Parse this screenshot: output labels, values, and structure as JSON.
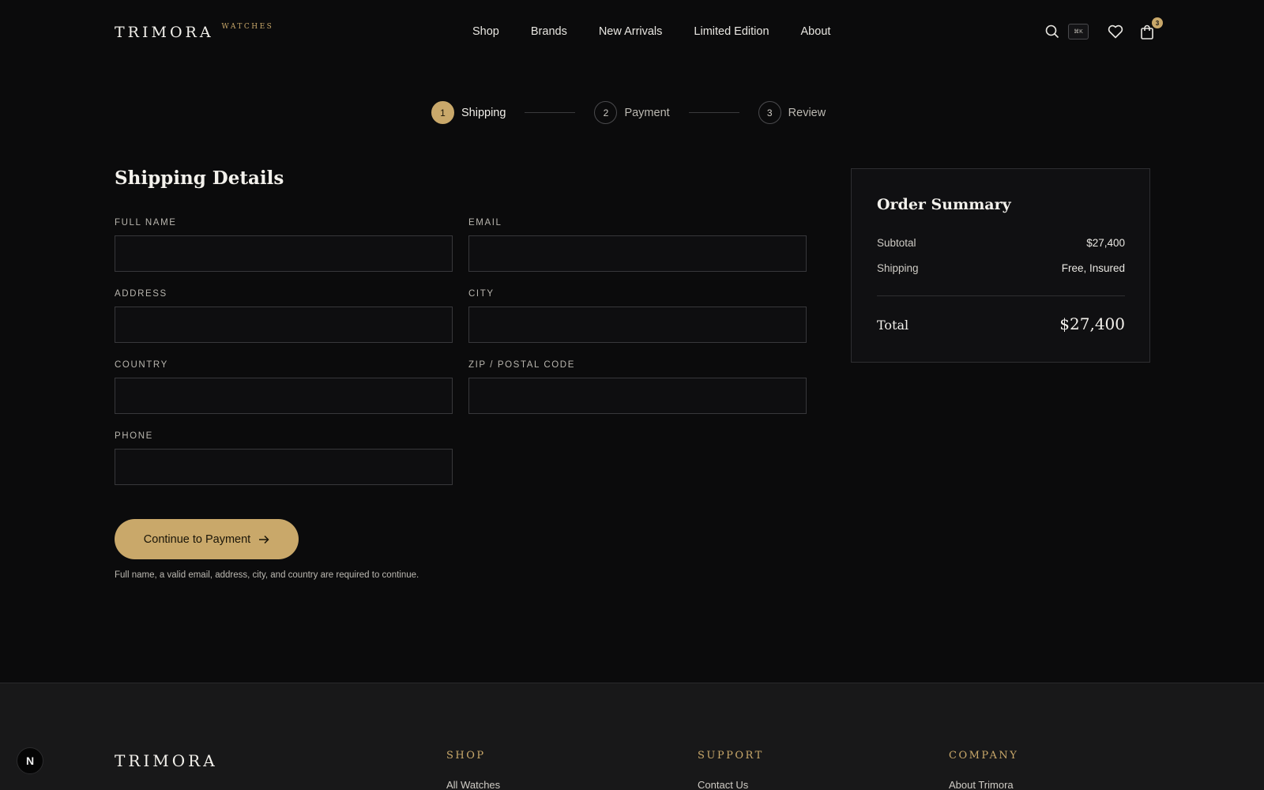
{
  "header": {
    "logo": "TRIMORA",
    "logo_sub": "WATCHES",
    "nav": [
      "Shop",
      "Brands",
      "New Arrivals",
      "Limited Edition",
      "About"
    ],
    "kbd_hint": "⌘K",
    "cart_count": "3"
  },
  "stepper": {
    "steps": [
      {
        "num": "1",
        "label": "Shipping"
      },
      {
        "num": "2",
        "label": "Payment"
      },
      {
        "num": "3",
        "label": "Review"
      }
    ]
  },
  "form": {
    "title": "Shipping Details",
    "fields": {
      "full_name": {
        "label": "FULL NAME",
        "value": ""
      },
      "email": {
        "label": "EMAIL",
        "value": ""
      },
      "address": {
        "label": "ADDRESS",
        "value": ""
      },
      "city": {
        "label": "CITY",
        "value": ""
      },
      "country": {
        "label": "COUNTRY",
        "value": ""
      },
      "zip": {
        "label": "ZIP / POSTAL CODE",
        "value": ""
      },
      "phone": {
        "label": "PHONE",
        "value": ""
      }
    },
    "continue_label": "Continue to Payment",
    "hint": "Full name, a valid email, address, city, and country are required to continue."
  },
  "summary": {
    "title": "Order Summary",
    "subtotal_label": "Subtotal",
    "subtotal_value": "$27,400",
    "shipping_label": "Shipping",
    "shipping_value": "Free, Insured",
    "total_label": "Total",
    "total_value": "$27,400"
  },
  "footer": {
    "logo": "TRIMORA",
    "columns": [
      {
        "heading": "SHOP",
        "first_link": "All Watches"
      },
      {
        "heading": "SUPPORT",
        "first_link": "Contact Us"
      },
      {
        "heading": "COMPANY",
        "first_link": "About Trimora"
      }
    ]
  },
  "dev_badge": "N",
  "colors": {
    "accent": "#c9a86a",
    "background": "#0b0b0c",
    "footer": "#181819"
  }
}
